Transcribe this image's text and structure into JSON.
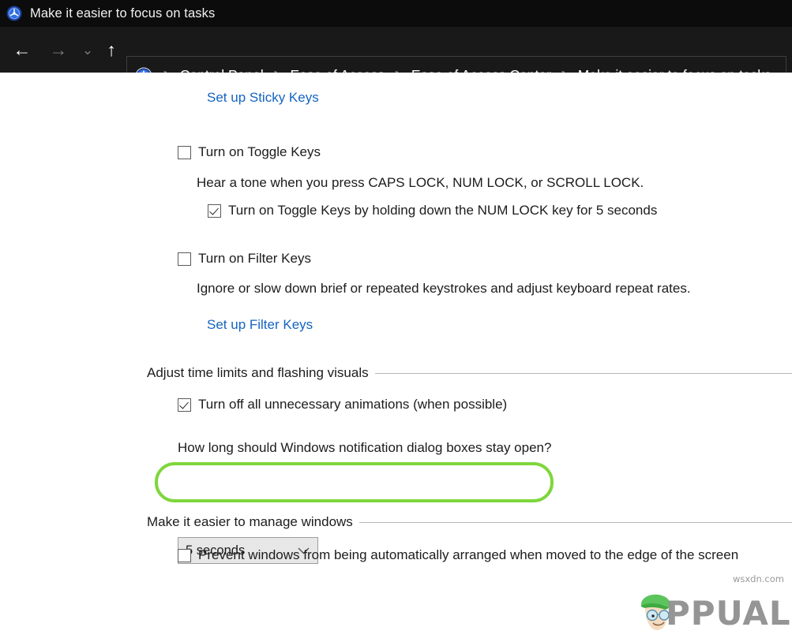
{
  "window": {
    "title": "Make it easier to focus on tasks",
    "icon": "ease-of-access-icon"
  },
  "nav": {
    "back_icon": "←",
    "forward_icon": "→",
    "recent_icon": "⌄",
    "up_icon": "↑",
    "separator": "❯",
    "breadcrumbs": [
      "Control Panel",
      "Ease of Access",
      "Ease of Access Center",
      "Make it easier to focus on tasks"
    ]
  },
  "content": {
    "sticky_keys_link": "Set up Sticky Keys",
    "toggle_keys": {
      "label": "Turn on Toggle Keys",
      "checked": false,
      "description": "Hear a tone when you press CAPS LOCK, NUM LOCK, or SCROLL LOCK.",
      "sub_option": {
        "label": "Turn on Toggle Keys by holding down the NUM LOCK key for 5 seconds",
        "checked": true
      }
    },
    "filter_keys": {
      "label": "Turn on Filter Keys",
      "checked": false,
      "description": "Ignore or slow down brief or repeated keystrokes and adjust keyboard repeat rates.",
      "link": "Set up Filter Keys"
    },
    "time_limits_group": {
      "heading": "Adjust time limits and flashing visuals",
      "animations_option": {
        "label": "Turn off all unnecessary animations (when possible)",
        "checked": true,
        "highlighted": true,
        "highlight_color": "#7ed63c"
      },
      "dialog_question": "How long should Windows notification dialog boxes stay open?",
      "dialog_duration_value": "5 seconds"
    },
    "manage_windows_group": {
      "heading": "Make it easier to manage windows",
      "prevent_arrange_option": {
        "label": "Prevent windows from being automatically arranged when moved to the edge of the screen",
        "checked": false
      }
    }
  },
  "watermark": {
    "brand": "PPUALS",
    "site": "wsxdn.com"
  }
}
